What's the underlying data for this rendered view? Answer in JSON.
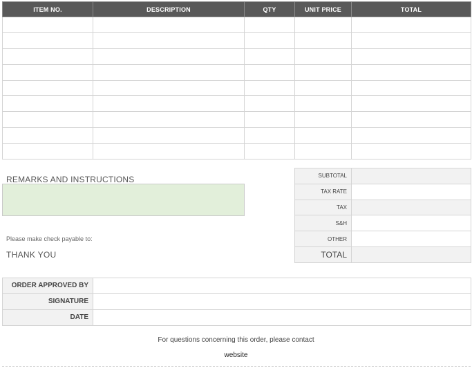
{
  "items_table": {
    "headers": [
      "ITEM NO.",
      "DESCRIPTION",
      "QTY",
      "UNIT PRICE",
      "TOTAL"
    ],
    "rows": [
      [
        "",
        "",
        "",
        "",
        ""
      ],
      [
        "",
        "",
        "",
        "",
        ""
      ],
      [
        "",
        "",
        "",
        "",
        ""
      ],
      [
        "",
        "",
        "",
        "",
        ""
      ],
      [
        "",
        "",
        "",
        "",
        ""
      ],
      [
        "",
        "",
        "",
        "",
        ""
      ],
      [
        "",
        "",
        "",
        "",
        ""
      ],
      [
        "",
        "",
        "",
        "",
        ""
      ],
      [
        "",
        "",
        "",
        "",
        ""
      ]
    ]
  },
  "remarks": {
    "label": "REMARKS AND INSTRUCTIONS",
    "value": "",
    "payable_text": "Please make check payable to:",
    "thank_you": "THANK YOU"
  },
  "totals": {
    "rows": [
      {
        "label": "SUBTOTAL",
        "value": ""
      },
      {
        "label": "TAX RATE",
        "value": ""
      },
      {
        "label": "TAX",
        "value": ""
      },
      {
        "label": "S&H",
        "value": ""
      },
      {
        "label": "OTHER",
        "value": ""
      },
      {
        "label": "TOTAL",
        "value": ""
      }
    ]
  },
  "approval": {
    "rows": [
      {
        "label": "ORDER APPROVED BY",
        "value": ""
      },
      {
        "label": "SIGNATURE",
        "value": ""
      },
      {
        "label": "DATE",
        "value": ""
      }
    ]
  },
  "footer": {
    "contact_text": "For questions concerning this order, please contact",
    "website": "website"
  },
  "colors": {
    "header_bg": "#595959",
    "label_bg": "#f2f2f2",
    "remarks_bg": "#e2efda",
    "border": "#d4d4d4"
  }
}
